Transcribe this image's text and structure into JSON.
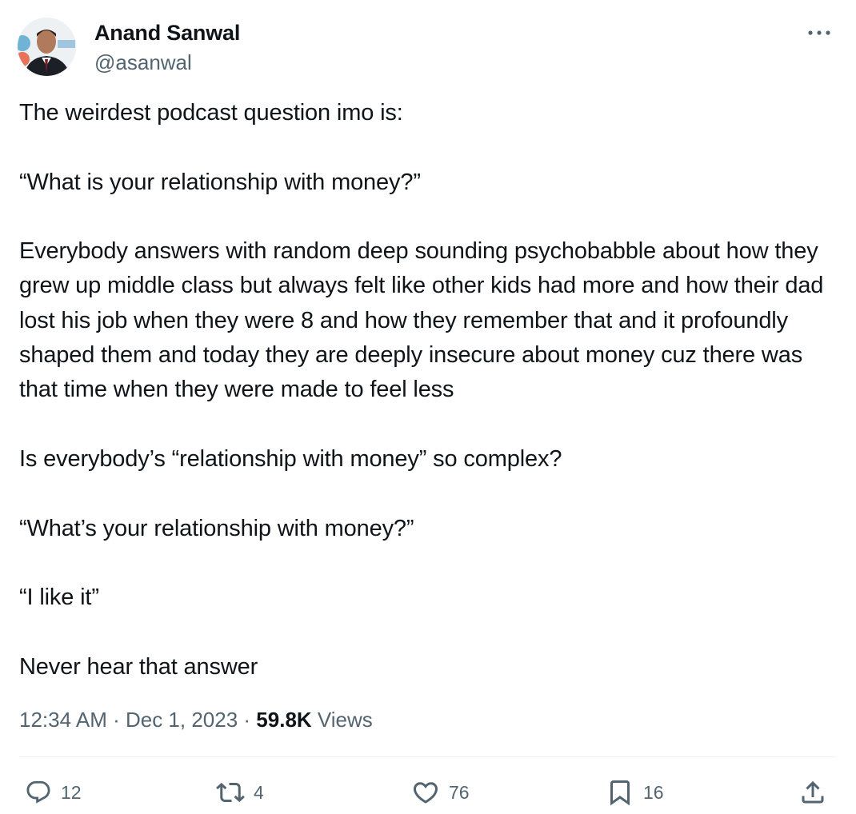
{
  "author": {
    "display_name": "Anand Sanwal",
    "handle": "@asanwal"
  },
  "tweet": {
    "paragraphs": [
      "The weirdest podcast question imo is:",
      "“What is your relationship with money?”",
      "Everybody answers with random deep sounding psychobabble about how they grew up middle class but always felt like other kids had more and how their dad lost his job when they were 8 and how they remember that and it profoundly shaped them and today they are deeply insecure about money cuz there was that time when they were made to feel less",
      "Is everybody’s “relationship with money” so complex?",
      "“What’s your relationship with money?”",
      "“I like it”",
      "Never hear that answer"
    ]
  },
  "meta": {
    "time": "12:34 AM",
    "separator": " · ",
    "date": "Dec 1, 2023",
    "views_count": "59.8K",
    "views_label": " Views"
  },
  "actions": {
    "replies": "12",
    "reposts": "4",
    "likes": "76",
    "bookmarks": "16"
  },
  "icons": {
    "more": "more-horizontal-icon",
    "reply": "reply-icon",
    "repost": "repost-icon",
    "like": "heart-icon",
    "bookmark": "bookmark-icon",
    "share": "share-icon"
  },
  "colors": {
    "text_primary": "#0f1419",
    "text_secondary": "#536471",
    "divider": "#eff3f4"
  }
}
